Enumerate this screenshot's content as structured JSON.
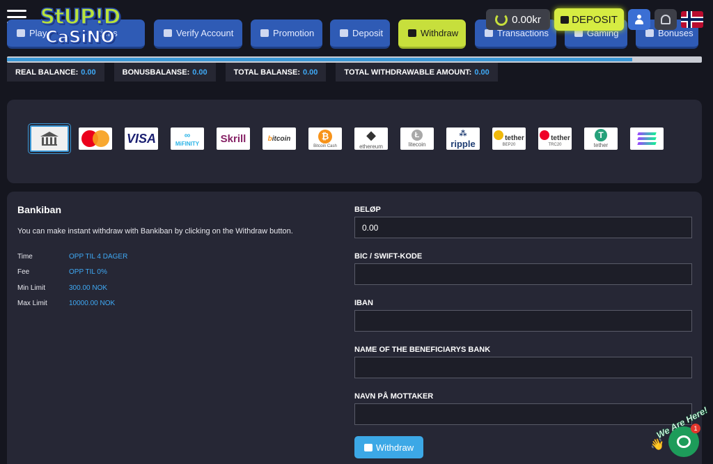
{
  "brand": {
    "line1": "StUP!D",
    "line2": "CaSiNO"
  },
  "topbar": {
    "balance": "0.00kr",
    "deposit_label": "DEPOSIT"
  },
  "tabs": [
    {
      "label": "Play",
      "icon": "user-icon"
    },
    {
      "label": "Verify Account",
      "icon": "user-check-icon"
    },
    {
      "label": "Promotion",
      "icon": "users-icon"
    },
    {
      "label": "Deposit",
      "icon": "coins-icon"
    },
    {
      "label": "Withdraw",
      "icon": "wallet-icon",
      "active": true
    },
    {
      "label": "Transactions",
      "icon": "money-icon"
    },
    {
      "label": "Gaming",
      "icon": "gamepad-icon"
    },
    {
      "label": "Bonuses",
      "icon": "gift-icon"
    }
  ],
  "tab_extra_fragment": "tions",
  "progress": {
    "value_fraction": 0.9
  },
  "stats": [
    {
      "label": "REAL BALANCE:",
      "value": "0.00"
    },
    {
      "label": "BONUSBALANSE:",
      "value": "0.00"
    },
    {
      "label": "TOTAL BALANSE:",
      "value": "0.00"
    },
    {
      "label": "TOTAL WITHDRAWABLE AMOUNT:",
      "value": "0.00"
    }
  ],
  "methods": [
    {
      "name": "bank",
      "selected": true
    },
    {
      "name": "mastercard"
    },
    {
      "name": "visa",
      "text": "VISA"
    },
    {
      "name": "mifinity",
      "text": "MiFINITY"
    },
    {
      "name": "skrill",
      "text": "Skrill"
    },
    {
      "name": "bitcoin",
      "text": "bitcoin"
    },
    {
      "name": "bitcoin-cash",
      "text": "Bitcoin Cash"
    },
    {
      "name": "ethereum",
      "text": "ethereum"
    },
    {
      "name": "litecoin",
      "text": "litecoin"
    },
    {
      "name": "ripple",
      "text": "ripple"
    },
    {
      "name": "tether-bep20",
      "text": "tether",
      "sub": "BEP20"
    },
    {
      "name": "tether-trc20",
      "text": "tether",
      "sub": "TRC20"
    },
    {
      "name": "tether",
      "text": "tether"
    },
    {
      "name": "solana"
    }
  ],
  "panel": {
    "title": "Bankiban",
    "description": "You can make instant withdraw with Bankiban by clicking on the Withdraw button.",
    "info": [
      {
        "label": "Time",
        "value": "OPP TIL 4 DAGER"
      },
      {
        "label": "Fee",
        "value": "OPP TIL 0%"
      },
      {
        "label": "Min Limit",
        "value": "300.00 NOK"
      },
      {
        "label": "Max Limit",
        "value": "10000.00 NOK"
      }
    ]
  },
  "form": {
    "amount_label": "BELØP",
    "amount_value": "0.00",
    "bic_label": "BIC / SWIFT-KODE",
    "iban_label": "IBAN",
    "bank_label": "NAME OF THE BENEFICIARYS BANK",
    "receiver_label": "NAVN PÅ MOTTAKER",
    "submit_label": "Withdraw"
  },
  "chat": {
    "badge": "1",
    "banner": "We Are Here!"
  }
}
